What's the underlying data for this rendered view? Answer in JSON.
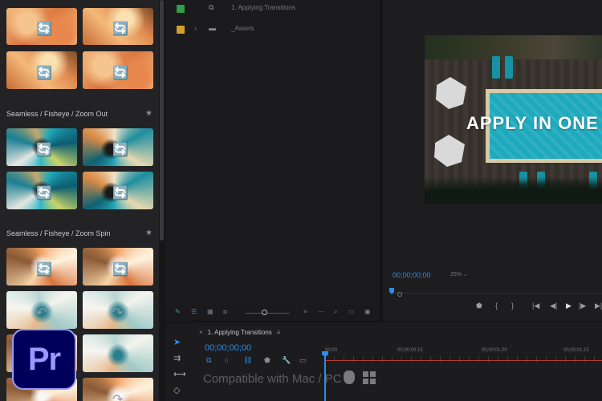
{
  "transitions_panel": {
    "sections": [
      {
        "label": "Seamless / Fisheye / Zoom Out"
      },
      {
        "label": "Seamless / Fisheye / Zoom Spin"
      }
    ],
    "star_icon": "★"
  },
  "project_panel": {
    "rows": [
      {
        "label": "1. Applying Transitions",
        "color": "#2e9e4a"
      },
      {
        "label": "_Assets",
        "color": "#d4a02c"
      }
    ]
  },
  "program_monitor": {
    "video_title": "APPLY IN ONE",
    "timecode": "00;00;00;00",
    "zoom": "25%"
  },
  "timeline": {
    "tab_label": "1. Applying Transitions",
    "timecode": "00;00;00;00",
    "ruler_labels": [
      "00;00",
      "00;00;00;15",
      "00;00;01;00",
      "00;00;01;15"
    ]
  },
  "overlay": {
    "app_logo": "Pr",
    "compat_text": "Compatible with Mac / PC"
  },
  "colors": {
    "accent": "#2d8ceb",
    "premiere_bg": "#00005b",
    "premiere_fg": "#9999ff"
  }
}
